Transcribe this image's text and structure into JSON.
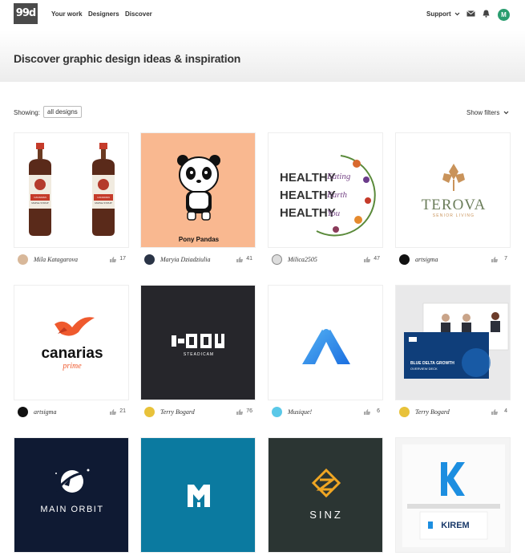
{
  "nav": {
    "logo": "99d",
    "links": [
      "Your work",
      "Designers",
      "Discover"
    ],
    "support": "Support",
    "user_initial": "M"
  },
  "hero": {
    "title": "Discover graphic design ideas & inspiration"
  },
  "filters": {
    "showing_label": "Showing:",
    "selected": "all designs",
    "toggle": "Show filters"
  },
  "designs": [
    {
      "designer": "Mila Katagarova",
      "likes": "17",
      "art_text": [
        "CANADIAN",
        "MAPLE SYRUP"
      ]
    },
    {
      "designer": "Maryia Dziadziulia",
      "likes": "41",
      "art_text": [
        "Pony Pandas"
      ]
    },
    {
      "designer": "Milica2505",
      "likes": "47",
      "art_text": [
        "HEALTHY",
        "HEALTHY",
        "HEALTHY",
        "Eating",
        "Earth",
        "You"
      ]
    },
    {
      "designer": "artsigma",
      "likes": "7",
      "art_text": [
        "TEROVA",
        "SENIOR LIVING"
      ]
    },
    {
      "designer": "artsigma",
      "likes": "21",
      "art_text": [
        "canarias",
        "prime"
      ]
    },
    {
      "designer": "Terry Bogard",
      "likes": "76",
      "art_text": [
        "STEADICAM"
      ]
    },
    {
      "designer": "Musique!",
      "likes": "6",
      "art_text": []
    },
    {
      "designer": "Terry Bogard",
      "likes": "4",
      "art_text": [
        "BLUE DELTA GROWTH",
        "OVERVIEW DECK"
      ]
    },
    {
      "designer": "",
      "likes": "",
      "art_text": [
        "MAIN ORBIT"
      ]
    },
    {
      "designer": "",
      "likes": "",
      "art_text": []
    },
    {
      "designer": "",
      "likes": "",
      "art_text": [
        "SINZ"
      ]
    },
    {
      "designer": "",
      "likes": "",
      "art_text": [
        "KIREM"
      ]
    }
  ],
  "colors": {
    "accent_green": "#2a9d6f",
    "peach": "#f9b890",
    "navy": "#0f1a33",
    "teal": "#0b7aa0",
    "charcoal": "#2b3533"
  }
}
